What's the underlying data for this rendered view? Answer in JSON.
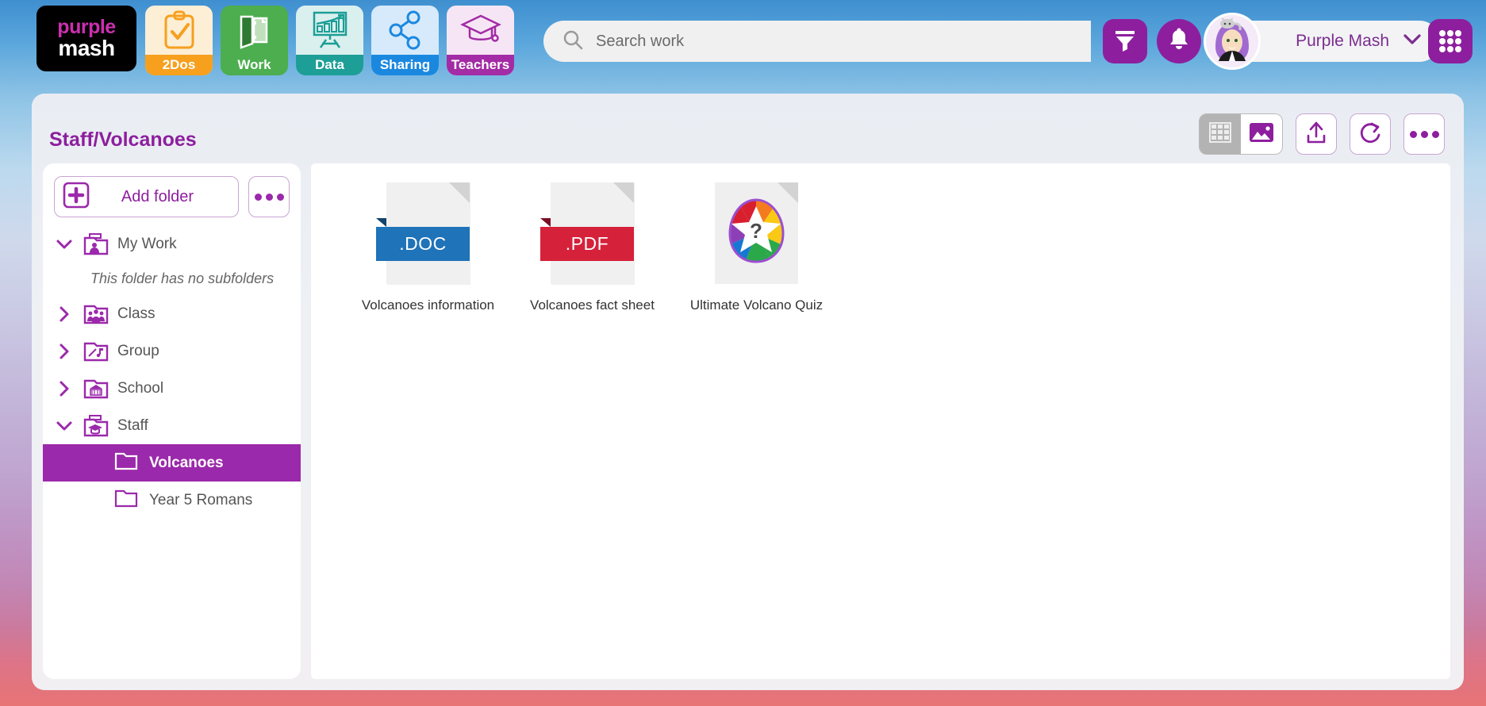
{
  "app": {
    "logo_line1": "purple",
    "logo_line2": "mash"
  },
  "nav": {
    "tabs": [
      {
        "label": "2Dos",
        "icon": "clipboard-check-icon",
        "bg": "#fdeed6",
        "label_bg": "#f6a01e"
      },
      {
        "label": "Work",
        "icon": "open-folder-document-icon",
        "bg": "#4cae4f",
        "label_bg": "#4cae4f"
      },
      {
        "label": "Data",
        "icon": "chart-easel-icon",
        "bg": "#daf0ee",
        "label_bg": "#1d9e96"
      },
      {
        "label": "Sharing",
        "icon": "share-nodes-icon",
        "bg": "#d6eafb",
        "label_bg": "#1b88e0"
      },
      {
        "label": "Teachers",
        "icon": "graduation-cap-icon",
        "bg": "#f6e6f5",
        "label_bg": "#a32ba5"
      }
    ]
  },
  "search": {
    "placeholder": "Search work",
    "value": "",
    "icon": "search-icon"
  },
  "header_actions": {
    "filter_icon": "filter-funnel-icon",
    "notifications_icon": "bell-icon",
    "apps_icon": "apps-grid-icon",
    "accent": "#8d1f9e"
  },
  "user": {
    "name": "Purple Mash",
    "avatar_icon": "user-avatar",
    "chevron_icon": "chevron-down-icon"
  },
  "page": {
    "breadcrumb": "Staff/Volcanoes"
  },
  "toolbar": {
    "view_list_label": "List view",
    "view_list_icon": "grid-list-icon",
    "view_thumb_label": "Thumbnail view",
    "view_thumb_icon": "image-icon",
    "view_selected": "thumbnail",
    "upload_label": "Upload",
    "upload_icon": "upload-icon",
    "refresh_label": "Refresh",
    "refresh_icon": "refresh-icon",
    "more_label": "More options",
    "more_icon": "ellipsis-icon"
  },
  "sidebar": {
    "add_folder_label": "Add folder",
    "add_folder_icon": "plus-square-icon",
    "more_label": "More folder options",
    "more_icon": "ellipsis-icon",
    "empty_message": "This folder has no subfolders",
    "tree": [
      {
        "label": "My Work",
        "icon": "my-work-folder-icon",
        "expanded": true,
        "chevron": "chevron-down-icon"
      },
      {
        "label": "Class",
        "icon": "class-folder-icon",
        "expanded": false,
        "chevron": "chevron-right-icon"
      },
      {
        "label": "Group",
        "icon": "group-folder-icon",
        "expanded": false,
        "chevron": "chevron-right-icon"
      },
      {
        "label": "School",
        "icon": "school-folder-icon",
        "expanded": false,
        "chevron": "chevron-right-icon"
      },
      {
        "label": "Staff",
        "icon": "staff-folder-icon",
        "expanded": true,
        "chevron": "chevron-down-icon"
      }
    ],
    "subfolders": [
      {
        "label": "Volcanoes",
        "icon": "folder-icon",
        "selected": true
      },
      {
        "label": "Year 5 Romans",
        "icon": "folder-icon",
        "selected": false
      }
    ],
    "selected_color": "#9b29ab"
  },
  "files": [
    {
      "name": "Volcanoes information",
      "type": "doc",
      "badge": ".DOC",
      "badge_color": "#1f73b8",
      "badge_shadow": "#12436b",
      "icon": "doc-file-icon"
    },
    {
      "name": "Volcanoes fact sheet",
      "type": "pdf",
      "badge": ".PDF",
      "badge_color": "#d5213a",
      "badge_shadow": "#7d1022",
      "icon": "pdf-file-icon"
    },
    {
      "name": "Ultimate Volcano Quiz",
      "type": "quiz",
      "badge": "",
      "badge_color": "",
      "badge_shadow": "",
      "icon": "quiz-star-icon"
    }
  ]
}
